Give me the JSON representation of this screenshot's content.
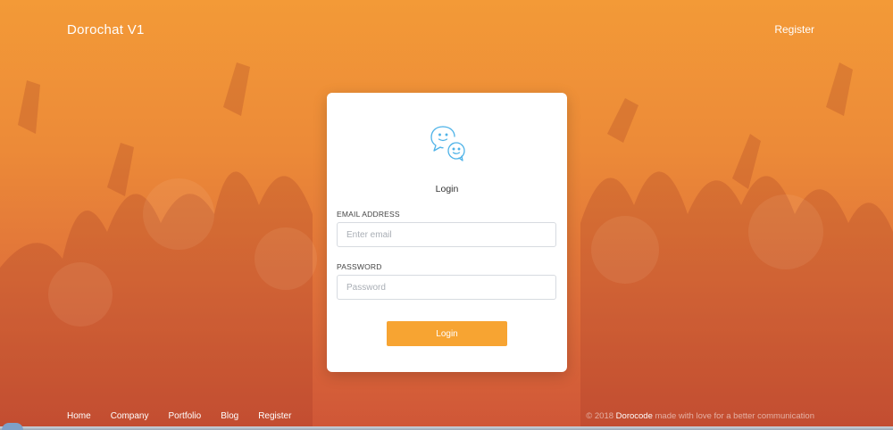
{
  "app": {
    "brand": "Dorochat V1",
    "top_register_label": "Register"
  },
  "login_card": {
    "logo_icon": "chat-bubbles-icon",
    "title": "Login",
    "email_label": "EMAIL ADDRESS",
    "email_placeholder": "Enter email",
    "email_value": "",
    "password_label": "PASSWORD",
    "password_placeholder": "Password",
    "password_value": "",
    "submit_label": "Login"
  },
  "footer": {
    "nav": [
      "Home",
      "Company",
      "Portfolio",
      "Blog",
      "Register"
    ],
    "copyright_prefix": "© 2018",
    "copyright_brand": "Dorocode",
    "copyright_suffix": "made with love for a better communication"
  },
  "colors": {
    "accent": "#f7a432",
    "background_top": "#f39a37",
    "background_bottom": "#cf5637",
    "logo_stroke": "#4fb3e8"
  }
}
